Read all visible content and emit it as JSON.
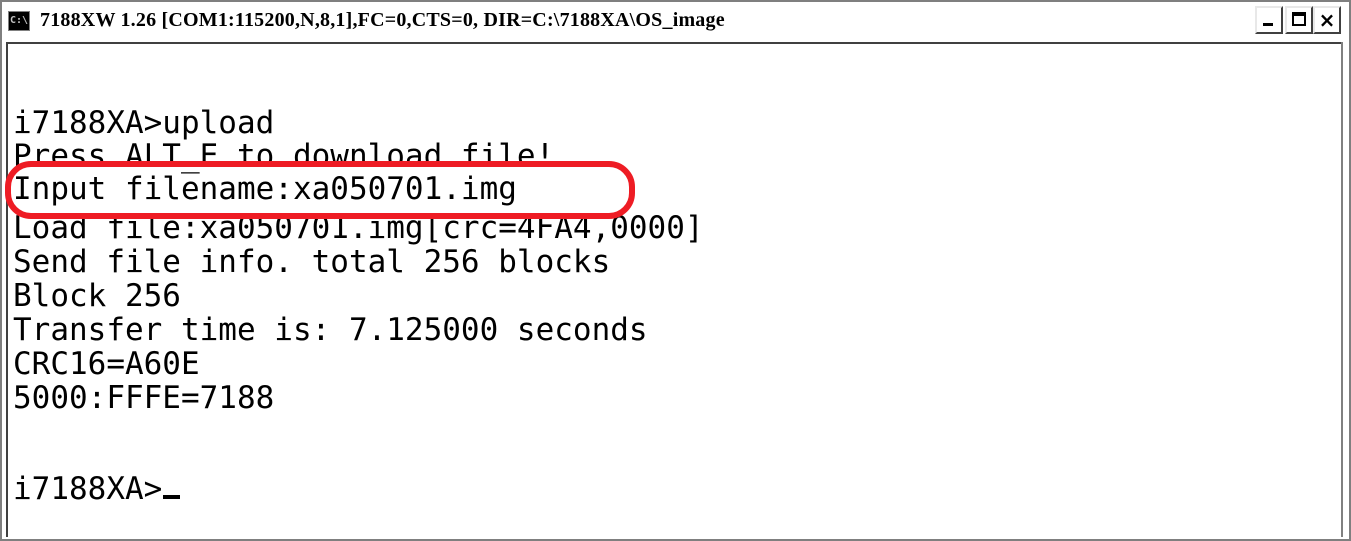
{
  "window": {
    "title": "7188XW 1.26 [COM1:115200,N,8,1],FC=0,CTS=0, DIR=C:\\7188XA\\OS_image",
    "icon_label": "C:\\",
    "controls": {
      "minimize_label": "_",
      "maximize_label": "□",
      "close_label": "×"
    }
  },
  "console": {
    "lines": [
      "i7188XA>upload",
      "Press ALT_E to download file!",
      "Input filename:xa050701.img",
      "Load file:xa050701.img[crc=4FA4,0000]",
      "Send file info. total 256 blocks",
      "Block 256",
      "Transfer time is: 7.125000 seconds",
      "CRC16=A60E",
      "5000:FFFE=7188",
      "",
      "i7188XA>"
    ]
  },
  "annotation": {
    "color": "#ee1c24",
    "target": "Input filename:xa050701.img"
  }
}
